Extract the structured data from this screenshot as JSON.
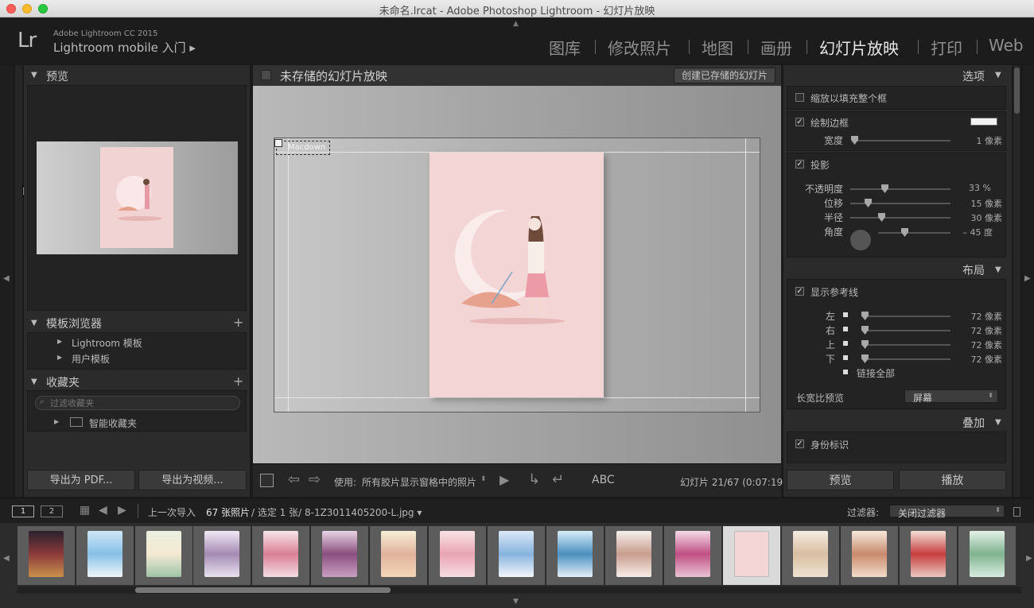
{
  "window": {
    "title": "未命名.lrcat - Adobe Photoshop Lightroom - 幻灯片放映"
  },
  "identity": {
    "logo": "Lr",
    "version": "Adobe Lightroom CC 2015",
    "mobile": "Lightroom mobile 入门 ▸"
  },
  "modules": [
    "图库",
    "修改照片",
    "地图",
    "画册",
    "幻灯片放映",
    "打印",
    "Web"
  ],
  "left_panel": {
    "preview_title": "预览",
    "templates_title": "模板浏览器",
    "templates": [
      "Lightroom 模板",
      "用户模板"
    ],
    "collections_title": "收藏夹",
    "collections_search_placeholder": "过滤收藏夹",
    "collections": [
      "智能收藏夹"
    ],
    "export_pdf": "导出为 PDF...",
    "export_video": "导出为视频..."
  },
  "center": {
    "header_title": "未存储的幻灯片放映",
    "create_button": "创建已存储的幻灯片",
    "identity_text": "Macdown",
    "toolbar": {
      "use_label": "使用:",
      "use_value": "所有胶片显示窗格中的照片",
      "abc": "ABC",
      "slide_info": "幻灯片 21/67 (0:07:19)"
    }
  },
  "right_panel": {
    "options_title": "选项",
    "zoom_fill": "缩放以填充整个框",
    "stroke_border": "绘制边框",
    "width_label": "宽度",
    "width_value": "1 像素",
    "stroke_border_checked": true,
    "shadow": "投影",
    "shadow_checked": true,
    "opacity_label": "不透明度",
    "opacity_value": "33 %",
    "offset_label": "位移",
    "offset_value": "15 像素",
    "radius_label": "半径",
    "radius_value": "30 像素",
    "angle_label": "角度",
    "angle_value": "– 45 度",
    "layout_title": "布局",
    "show_guides": "显示参考线",
    "guides": [
      {
        "label": "左",
        "value": "72 像素"
      },
      {
        "label": "右",
        "value": "72 像素"
      },
      {
        "label": "上",
        "value": "72 像素"
      },
      {
        "label": "下",
        "value": "72 像素"
      }
    ],
    "link_all": "链接全部",
    "aspect_label": "长宽比预览",
    "aspect_value": "屏幕",
    "overlay_title": "叠加",
    "identity_plate": "身份标识",
    "preview_button": "预览",
    "play_button": "播放"
  },
  "filmbar": {
    "view1": "1",
    "view2": "2",
    "source": "上一次导入",
    "count": "67 张照片",
    "selection": "/ 选定 1 张/ 8-1Z3011405200-L.jpg ▾",
    "filter_label": "过滤器:",
    "filter_value": "关闭过滤器"
  },
  "colors": {
    "accent": "#e8e8e8",
    "panel": "#2b2b2b",
    "slide_bg": "#f3d5d5"
  }
}
